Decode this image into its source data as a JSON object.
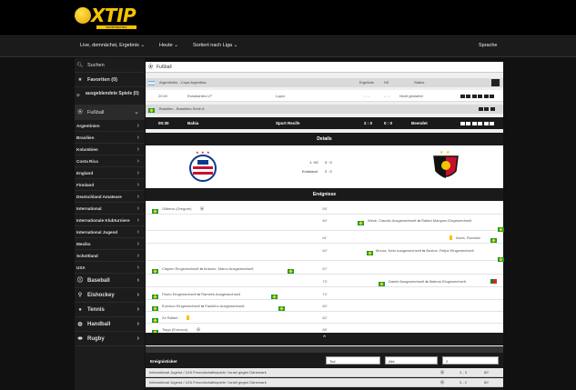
{
  "header": {
    "logo_text": "XTIP",
    "logo_subtext": "SPORTWETTEN",
    "nav": {
      "live_label": "Live, demnächst, Ergebnis",
      "today_label": "Heute",
      "sort_label": "Sortiert nach Liga",
      "language_label": "Sprache"
    }
  },
  "sidebar": {
    "search_label": "Suchen",
    "favorites_label": "Favoriten (0)",
    "hidden_label": "ausgeblendete Spiele (0)",
    "football_label": "Fußball",
    "countries": [
      "Argentinien",
      "Brasilien",
      "Kolumbien",
      "Costa Rica",
      "England",
      "Finnland",
      "Deutschland Amateure",
      "International",
      "Internationale Klubturniere",
      "International Jugend",
      "Mexiko",
      "Schottland",
      "USA"
    ],
    "sports": [
      "Baseball",
      "Eishockey",
      "Tennis",
      "Handball",
      "Rugby"
    ]
  },
  "main": {
    "section_title": "Fußball",
    "col_result": "Ergebnis",
    "col_ht": "HZ",
    "col_status": "Status",
    "league1": "Argentinien - Copa Argentina",
    "match1": {
      "time": "20:40",
      "home": "Estudiantes LP",
      "away": "Lujan",
      "result": "- : -",
      "ht": "- : -",
      "status": "Nicht gestartet"
    },
    "league2": "Brasilien - Brasileiro Serie A",
    "match2": {
      "time": "00:30",
      "home": "Bahia",
      "away": "Sport Recife",
      "result": "2 : 0",
      "ht": "0 : 0",
      "status": "Beendet"
    },
    "details_title": "Details",
    "ht_label": "1. HZ",
    "ht_score": "0 : 0",
    "final_label": "Endstand",
    "final_score": "2 : 0",
    "events_title": "Ereignisse",
    "events": [
      {
        "min": "55'",
        "left": "Gilberto (Gregore)",
        "right": ""
      },
      {
        "min": "60'",
        "left": "",
        "right": "Wesk, Claudio Ausgewechselt   ⇆   Rafael Marques Eingewechselt"
      },
      {
        "min": "61'",
        "left": "",
        "right": "Alves, Ronaldo"
      },
      {
        "min": "62'",
        "left": "",
        "right": "Moura, Neto Ausgewechselt   ⇆   Bustos, Felipe Eingewechselt"
      },
      {
        "min": "67'",
        "left": "Clayton Eingewechselt   ⇆   Antonio, Marco Ausgewechselt",
        "right": ""
      },
      {
        "min": "73'",
        "left": "",
        "right": "Daniel Ausgewechselt   ⇆   Mateus Eingewechselt"
      },
      {
        "min": "74'",
        "left": "Flavio Eingewechselt   ⇆   Ramires Ausgewechselt",
        "right": ""
      },
      {
        "min": "80'",
        "left": "Everson Eingewechselt   ⇆   Paulinho Ausgewechselt",
        "right": ""
      },
      {
        "min": "82'",
        "left": "Ze Rafael",
        "right": ""
      },
      {
        "min": "85'",
        "left": "Tiago (Everson)",
        "right": ""
      }
    ],
    "collapse_icon": "chevron-up-icon"
  },
  "ticker": {
    "title": "Ereignisticker",
    "filter1": "Tod",
    "filter2": "Alle",
    "filter3": "2",
    "rows": [
      {
        "text": "International Jugend / U16 Freundschaftsspiele / Israel gegen Dänemark",
        "score": "3 - 3",
        "min": "80'"
      },
      {
        "text": "International Jugend / U16 Freundschaftsspiele / Israel gegen Dänemark",
        "score": "3 - 2",
        "min": "80'"
      }
    ]
  },
  "colors": {
    "accent": "#f5c400",
    "dark": "#1a1a1a",
    "panel": "#efefef"
  }
}
